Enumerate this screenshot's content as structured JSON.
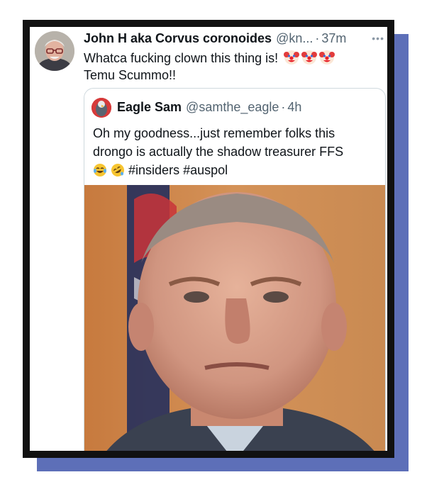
{
  "tweet": {
    "author_name": "John H aka Corvus coronoides",
    "author_handle": "@kn...",
    "separator": "·",
    "time": "37m",
    "more": "•••",
    "text_line1": "Whatca fucking clown this thing is!",
    "text_line2": "Temu Scummo!!",
    "emojis": [
      "clown-face",
      "clown-face",
      "clown-face"
    ]
  },
  "quoted_tweet": {
    "author_name": "Eagle Sam",
    "author_handle": "@samthe_eagle",
    "separator": "·",
    "time": "4h",
    "text_line1": "Oh my goodness...just remember folks this",
    "text_line2": "drongo is actually the shadow treasurer FFS",
    "hashtags": "#insiders #auspol",
    "emojis": [
      "face-with-tears-of-joy",
      "rolling-on-floor-laughing"
    ]
  },
  "colors": {
    "frame": "#111111",
    "shadow": "#5d6fb8",
    "secondary_text": "#536471",
    "border": "#cfd9de"
  }
}
